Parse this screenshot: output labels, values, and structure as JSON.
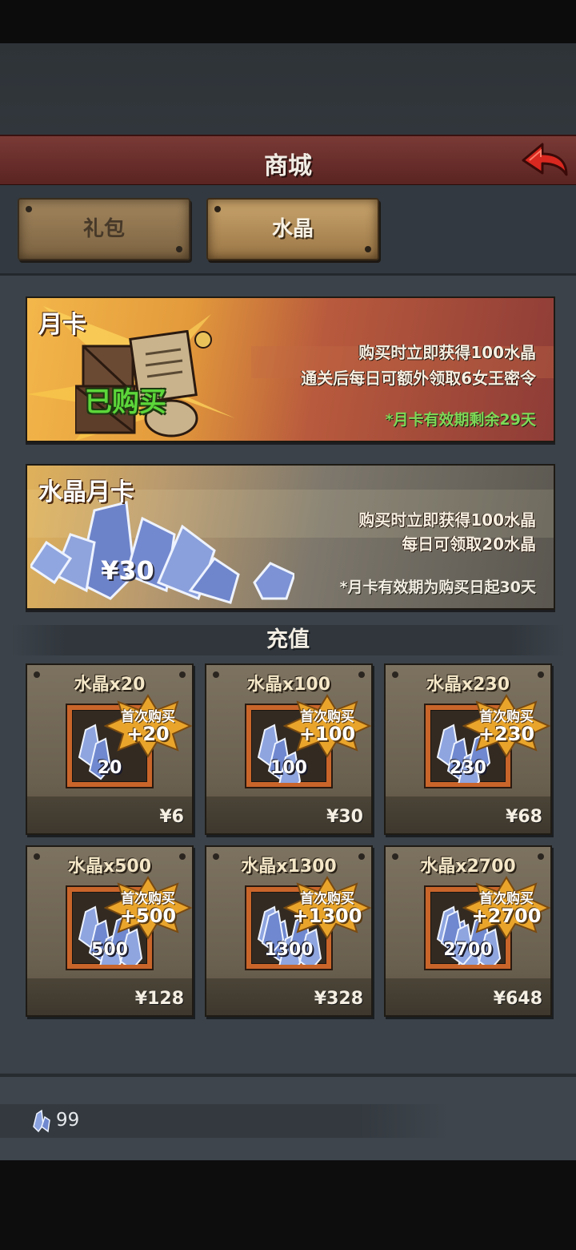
{
  "header": {
    "title": "商城"
  },
  "tabs": [
    {
      "label": "礼包",
      "active": false
    },
    {
      "label": "水晶",
      "active": true
    }
  ],
  "banners": {
    "monthly_card": {
      "title": "月卡",
      "stamp": "已购买",
      "line1": "购买时立即获得100水晶",
      "line2": "通关后每日可额外领取6女王密令",
      "note": "*月卡有效期剩余29天"
    },
    "crystal_card": {
      "title": "水晶月卡",
      "price": "¥30",
      "line1": "购买时立即获得100水晶",
      "line2": "每日可领取20水晶",
      "note": "*月卡有效期为购买日起30天"
    }
  },
  "recharge": {
    "section_title": "充值",
    "badge_label": "首次购买",
    "items": [
      {
        "title": "水晶x20",
        "amount": "20",
        "bonus": "+20",
        "price": "¥6"
      },
      {
        "title": "水晶x100",
        "amount": "100",
        "bonus": "+100",
        "price": "¥30"
      },
      {
        "title": "水晶x230",
        "amount": "230",
        "bonus": "+230",
        "price": "¥68"
      },
      {
        "title": "水晶x500",
        "amount": "500",
        "bonus": "+500",
        "price": "¥128"
      },
      {
        "title": "水晶x1300",
        "amount": "1300",
        "bonus": "+1300",
        "price": "¥328"
      },
      {
        "title": "水晶x2700",
        "amount": "2700",
        "bonus": "+2700",
        "price": "¥648"
      }
    ]
  },
  "footer": {
    "crystal_balance": "99"
  },
  "colors": {
    "header_red": "#6a2c29",
    "note_green": "#7ed957",
    "badge_gold": "#e9a52b",
    "frame_orange": "#c9652a"
  }
}
